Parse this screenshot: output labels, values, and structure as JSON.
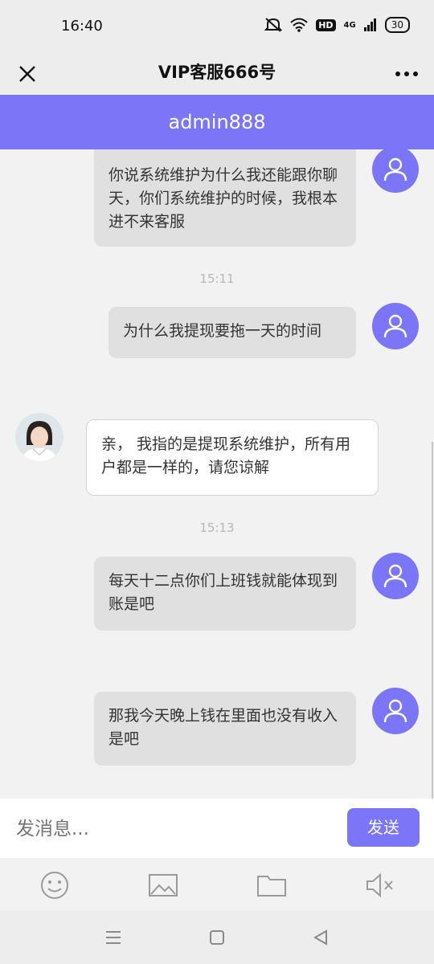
{
  "status_bar": {
    "time": "16:40",
    "hd": "HD",
    "signal": "4G",
    "battery": "30"
  },
  "title_bar": {
    "title": "VIP客服666号"
  },
  "chat_header": {
    "title": "admin888"
  },
  "messages": [
    {
      "sender": "user",
      "text": "你说系统维护为什么我还能跟你聊天，你们系统维护的时候，我根本进不来客服"
    },
    {
      "timestamp": "15:11"
    },
    {
      "sender": "user",
      "text": "为什么我提现要拖一天的时间"
    },
    {
      "sender": "agent",
      "text": "亲， 我指的是提现系统维护，所有用户都是一样的，请您谅解"
    },
    {
      "timestamp": "15:13"
    },
    {
      "sender": "user",
      "text": "每天十二点你们上班钱就能体现到账是吧"
    },
    {
      "sender": "user",
      "text": "那我今天晚上钱在里面也没有收入是吧"
    }
  ],
  "input": {
    "placeholder": "发消息..."
  },
  "send_button": {
    "label": "发送"
  },
  "toolbar": [
    "emoji-icon",
    "image-icon",
    "folder-icon",
    "mute-icon"
  ],
  "colors": {
    "accent": "#7b75f7",
    "user_bubble": "#e0e0e0",
    "agent_bubble": "#ffffff"
  }
}
